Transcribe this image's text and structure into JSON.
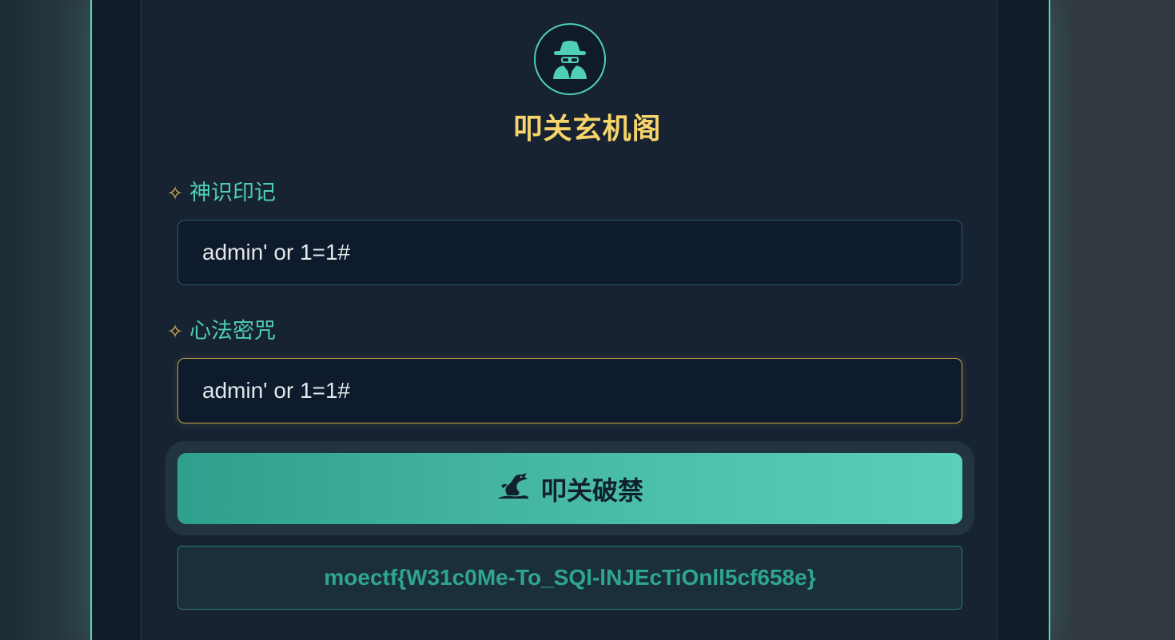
{
  "header": {
    "title": "叩关玄机阁",
    "emblem_icon": "spy-icon"
  },
  "form": {
    "username": {
      "label": "神识印记",
      "label_icon": "sparkle-icon",
      "value": "admin' or 1=1#"
    },
    "password": {
      "label": "心法密咒",
      "label_icon": "sparkle-icon",
      "value": "admin' or 1=1#"
    },
    "submit": {
      "label": "叩关破禁",
      "icon": "dragon-icon"
    }
  },
  "result": {
    "message": "moectf{W31c0Me-To_SQl-lNJEcTiOnll5cf658e}"
  },
  "colors": {
    "accent": "#4fcfb3",
    "title": "#f6d46a",
    "sparkle": "#e0b84f",
    "background": "#172332"
  }
}
